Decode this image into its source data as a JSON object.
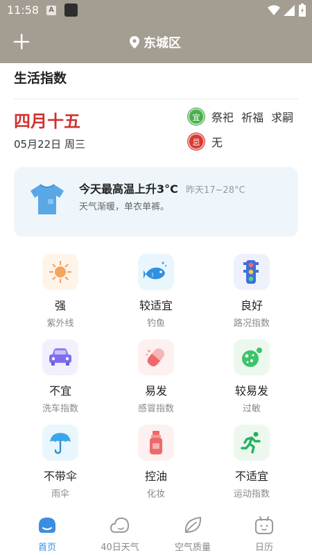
{
  "status_bar": {
    "time": "11:58",
    "notif_letter": "A"
  },
  "header": {
    "location": "东城区"
  },
  "section_title": "生活指数",
  "almanac": {
    "lunar_date": "四月十五",
    "solar_date": "05月22日 周三",
    "yi_badge": "宜",
    "yi_text": "祭祀 祈福 求嗣",
    "ji_badge": "忌",
    "ji_text": "无"
  },
  "tip": {
    "headline": "今天最高温上升3°C",
    "yesterday": "昨天17~28°C",
    "advice": "天气渐暖，单衣单裤。"
  },
  "indices": [
    {
      "value": "强",
      "name": "紫外线",
      "icon": "sun-icon",
      "bg": "#fff4ea"
    },
    {
      "value": "较适宜",
      "name": "钓鱼",
      "icon": "fish-icon",
      "bg": "#eaf6fd"
    },
    {
      "value": "良好",
      "name": "路况指数",
      "icon": "traffic-light-icon",
      "bg": "#eef1fb"
    },
    {
      "value": "不宜",
      "name": "洗车指数",
      "icon": "car-icon",
      "bg": "#f3f0fd"
    },
    {
      "value": "易发",
      "name": "感冒指数",
      "icon": "pill-icon",
      "bg": "#fdf0f0"
    },
    {
      "value": "较易发",
      "name": "过敏",
      "icon": "pollen-icon",
      "bg": "#ecf8ee"
    },
    {
      "value": "不带伞",
      "name": "雨伞",
      "icon": "umbrella-icon",
      "bg": "#eaf6fd"
    },
    {
      "value": "控油",
      "name": "化妆",
      "icon": "cosmetics-icon",
      "bg": "#fdf0f0"
    },
    {
      "value": "不适宜",
      "name": "运动指数",
      "icon": "running-icon",
      "bg": "#ecf8ee"
    }
  ],
  "bottom_nav": [
    {
      "label": "首页",
      "icon": "home-weather-icon",
      "active": true
    },
    {
      "label": "40日天气",
      "icon": "cloud-icon",
      "active": false
    },
    {
      "label": "空气质量",
      "icon": "leaf-icon",
      "active": false
    },
    {
      "label": "日历",
      "icon": "calendar-icon",
      "active": false
    }
  ],
  "colors": {
    "header_bg": "#a49d92",
    "lunar_red": "#d0312d",
    "yi_green": "#4caf50",
    "ji_red": "#d63a33",
    "nav_active": "#3b8de0",
    "tip_card_bg": "#eef6fc"
  }
}
